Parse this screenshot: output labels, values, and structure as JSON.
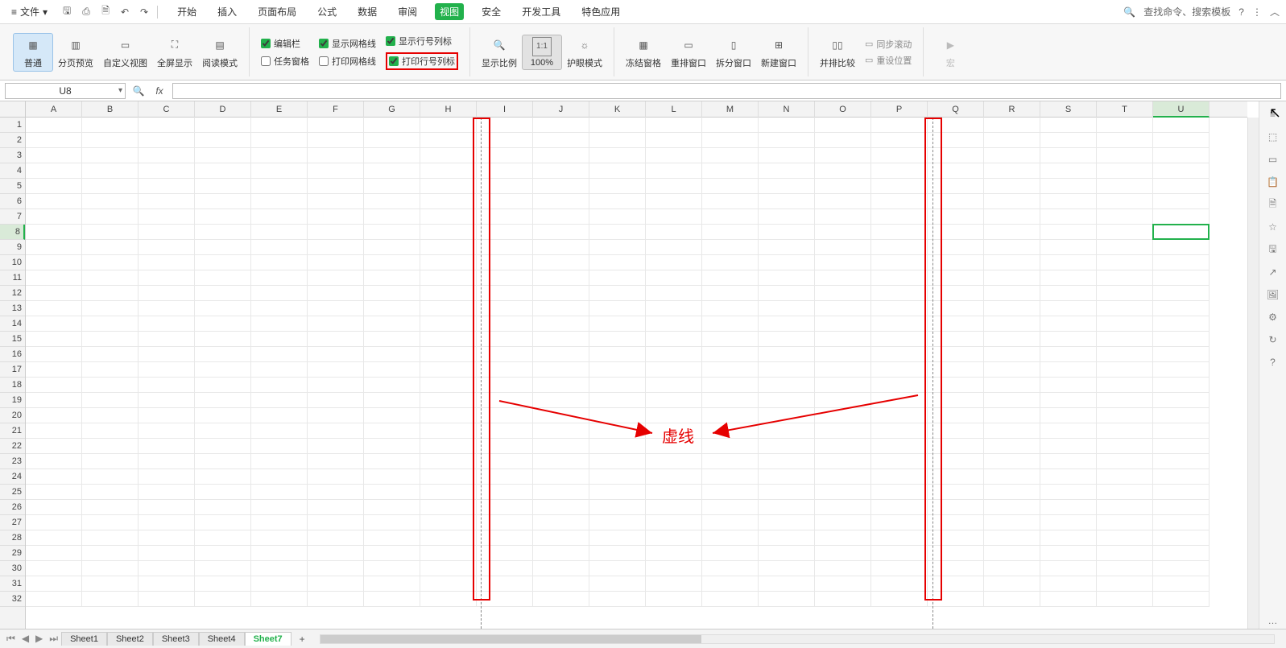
{
  "menu": {
    "file": "文件",
    "tabs": [
      "开始",
      "插入",
      "页面布局",
      "公式",
      "数据",
      "审阅",
      "视图",
      "安全",
      "开发工具",
      "特色应用"
    ],
    "active_tab": "视图",
    "search": "查找命令、搜索模板"
  },
  "ribbon": {
    "view_normal": "普通",
    "view_pagebreak": "分页预览",
    "view_custom": "自定义视图",
    "view_fullscreen": "全屏显示",
    "view_readmode": "阅读模式",
    "chk_editbar": "编辑栏",
    "chk_taskpane": "任务窗格",
    "chk_showgrid": "显示网格线",
    "chk_printgrid": "打印网格线",
    "chk_showhdr": "显示行号列标",
    "chk_printhdr": "打印行号列标",
    "zoom_ratio": "显示比例",
    "zoom_11": "1:1",
    "zoom_100": "100%",
    "eyecare": "护眼模式",
    "freeze": "冻结窗格",
    "arrange": "重排窗口",
    "split": "拆分窗口",
    "newwin": "新建窗口",
    "sidebyside": "并排比较",
    "syncscroll": "同步滚动",
    "resetpos": "重设位置",
    "macro": "宏"
  },
  "formula_bar": {
    "namebox": "U8",
    "fx": "fx"
  },
  "columns": [
    "A",
    "B",
    "C",
    "D",
    "E",
    "F",
    "G",
    "H",
    "I",
    "J",
    "K",
    "L",
    "M",
    "N",
    "O",
    "P",
    "Q",
    "R",
    "S",
    "T",
    "U"
  ],
  "rows": 32,
  "selected_cell": {
    "col": "U",
    "row": 8
  },
  "annotation_label": "虚线",
  "sheets": {
    "nav": [
      "⏮",
      "◀",
      "▶",
      "⏭"
    ],
    "tabs": [
      "Sheet1",
      "Sheet2",
      "Sheet3",
      "Sheet4",
      "Sheet7"
    ],
    "active": "Sheet7"
  }
}
